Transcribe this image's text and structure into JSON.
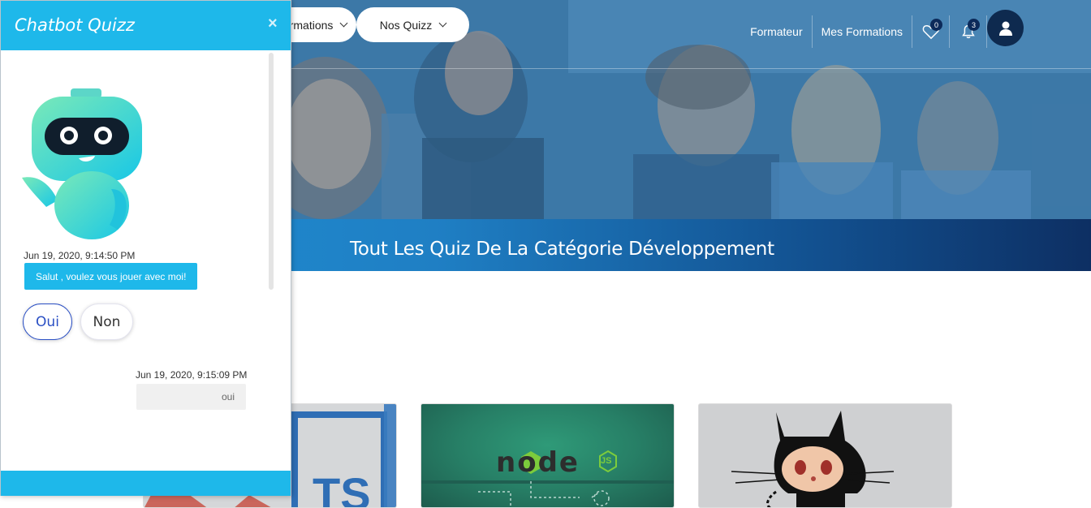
{
  "nav": {
    "formations_label": "Nos Formations",
    "quizz_label": "Nos Quizz",
    "formateur_label": "Formateur",
    "mes_formations_label": "Mes Formations",
    "wishlist_count": "0",
    "notifications_count": "3"
  },
  "banner": {
    "title": "Tout Les Quiz De La Catégorie Développement"
  },
  "cards": [
    {
      "name": "typescript",
      "label": "TS"
    },
    {
      "name": "nodejs",
      "label": "node",
      "sublabel": "JS"
    },
    {
      "name": "github",
      "label": ""
    }
  ],
  "chatbot": {
    "title": "Chatbot Quizz",
    "close_label": "×",
    "messages": [
      {
        "from": "bot",
        "time": "Jun 19, 2020, 9:14:50 PM",
        "text": "Salut , voulez vous jouer avec moi!"
      },
      {
        "from": "user",
        "time": "Jun 19, 2020, 9:15:09 PM",
        "text": "oui"
      }
    ],
    "options": [
      {
        "label": "Oui",
        "selected": true
      },
      {
        "label": "Non",
        "selected": false
      }
    ]
  },
  "colors": {
    "chat_accent": "#1eb8ea",
    "banner_start": "#1e90d4",
    "banner_end": "#0d2f63",
    "selected_option": "#2a4fc4",
    "avatar_bg": "#0e2a4f"
  }
}
